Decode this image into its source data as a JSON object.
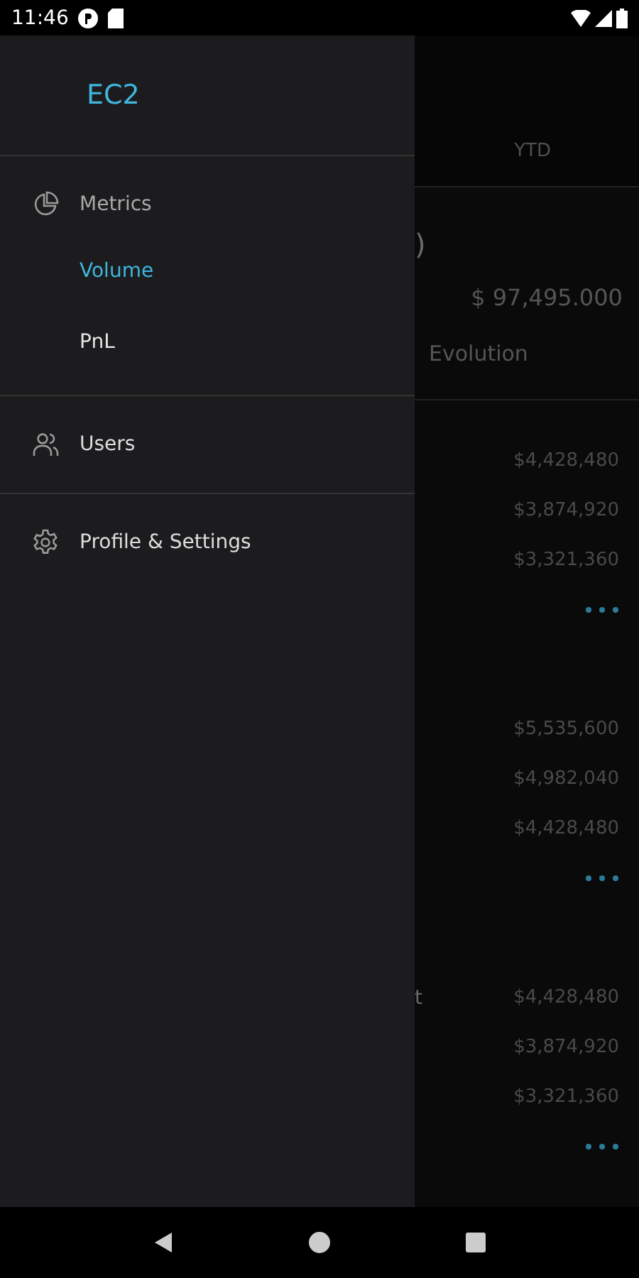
{
  "status_bar": {
    "time": "11:46"
  },
  "drawer": {
    "title": "EC2",
    "sections": [
      {
        "items": [
          {
            "label": "Metrics",
            "children": [
              {
                "label": "Volume",
                "selected": true
              },
              {
                "label": "PnL",
                "selected": false
              }
            ]
          }
        ]
      },
      {
        "items": [
          {
            "label": "Users"
          }
        ]
      },
      {
        "items": [
          {
            "label": "Profile & Settings"
          }
        ]
      }
    ]
  },
  "background_page": {
    "header_tab": "YTD",
    "summary": {
      "amount_fragment": ")",
      "total": "$ 97,495.000",
      "label": "Evolution"
    },
    "groups": [
      {
        "rows": [
          {
            "value": "$4,428,480"
          },
          {
            "value": "$3,874,920"
          },
          {
            "value": "$3,321,360"
          }
        ]
      },
      {
        "rows": [
          {
            "value": "$5,535,600"
          },
          {
            "value": "$4,982,040"
          },
          {
            "value": "$4,428,480"
          }
        ]
      },
      {
        "rows": [
          {
            "label": "t",
            "value": "$4,428,480"
          },
          {
            "value": "$3,874,920"
          },
          {
            "value": "$3,321,360"
          }
        ]
      }
    ]
  }
}
